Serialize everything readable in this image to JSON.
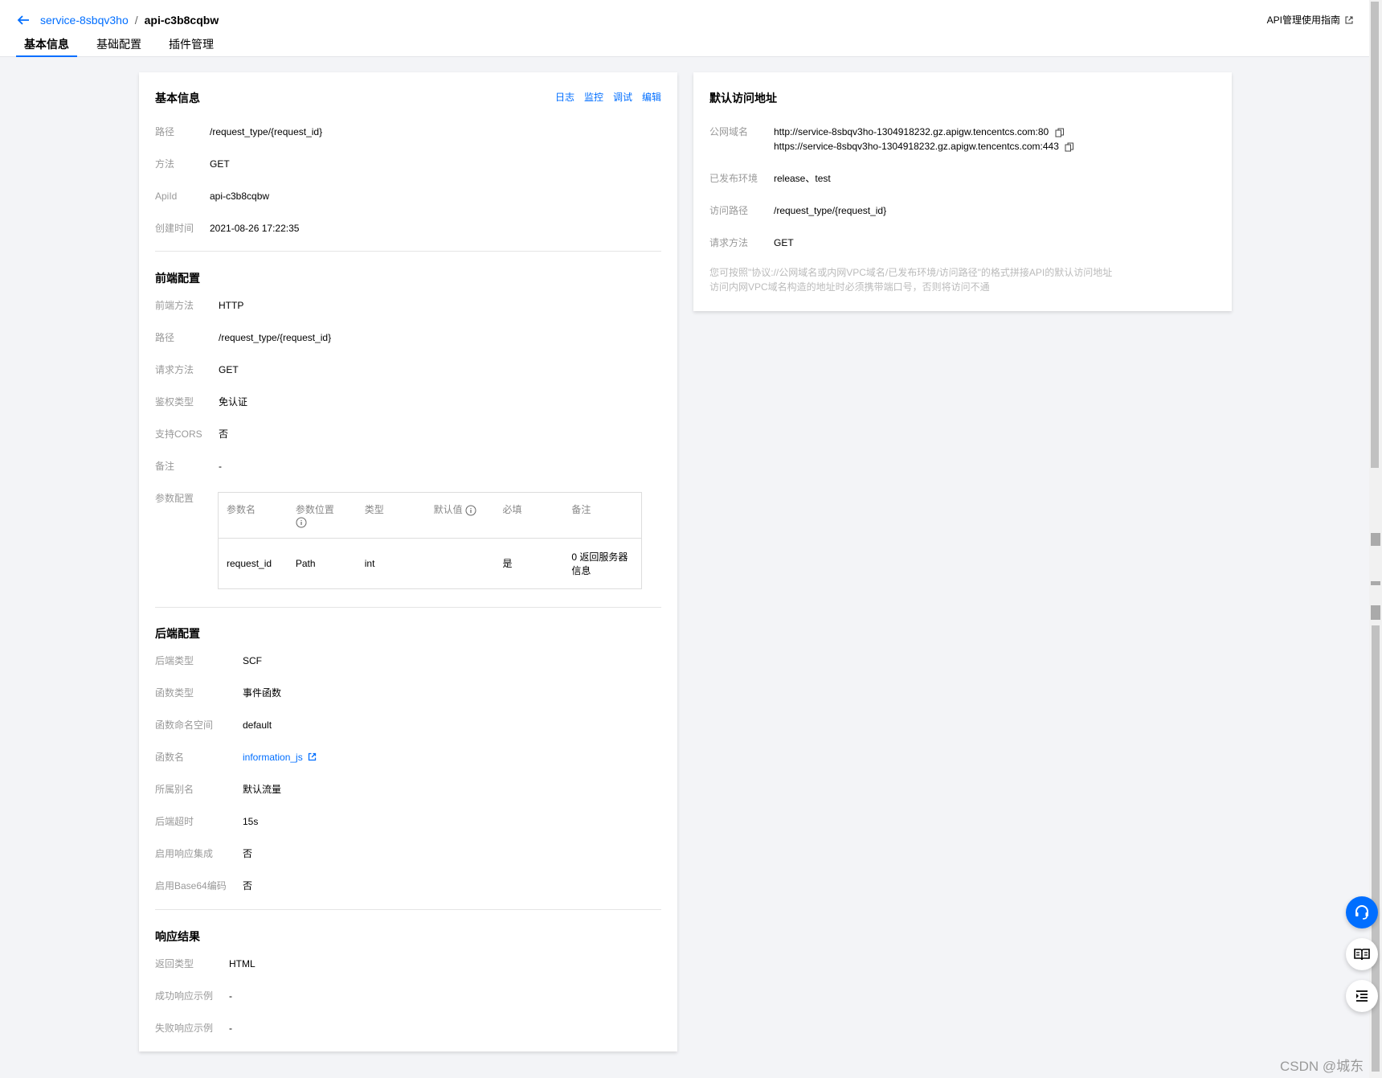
{
  "header": {
    "breadcrumb": {
      "service": "service-8sbqv3ho",
      "separator": "/",
      "current": "api-c3b8cqbw"
    },
    "guide_link": "API管理使用指南",
    "tabs": [
      "基本信息",
      "基础配置",
      "插件管理"
    ]
  },
  "basic_info": {
    "title": "基本信息",
    "actions": [
      "日志",
      "监控",
      "调试",
      "编辑"
    ],
    "rows": [
      {
        "label": "路径",
        "value": "/request_type/{request_id}"
      },
      {
        "label": "方法",
        "value": "GET"
      },
      {
        "label": "ApiId",
        "value": "api-c3b8cqbw"
      },
      {
        "label": "创建时间",
        "value": "2021-08-26 17:22:35"
      }
    ]
  },
  "frontend": {
    "title": "前端配置",
    "rows": [
      {
        "label": "前端方法",
        "value": "HTTP"
      },
      {
        "label": "路径",
        "value": "/request_type/{request_id}"
      },
      {
        "label": "请求方法",
        "value": "GET"
      },
      {
        "label": "鉴权类型",
        "value": "免认证"
      },
      {
        "label": "支持CORS",
        "value": "否"
      },
      {
        "label": "备注",
        "value": "-"
      }
    ],
    "param_label": "参数配置",
    "param_headers": [
      "参数名",
      "参数位置",
      "类型",
      "默认值",
      "必填",
      "备注"
    ],
    "param_rows": [
      {
        "name": "request_id",
        "position": "Path",
        "type": "int",
        "default": "",
        "required": "是",
        "note": "0 返回服务器信息"
      }
    ]
  },
  "backend": {
    "title": "后端配置",
    "rows": [
      {
        "label": "后端类型",
        "value": "SCF"
      },
      {
        "label": "函数类型",
        "value": "事件函数"
      },
      {
        "label": "函数命名空间",
        "value": "default"
      },
      {
        "label": "函数名",
        "value": "information_js"
      },
      {
        "label": "所属别名",
        "value": "默认流量"
      },
      {
        "label": "后端超时",
        "value": "15s"
      },
      {
        "label": "启用响应集成",
        "value": "否"
      },
      {
        "label": "启用Base64编码",
        "value": "否"
      }
    ]
  },
  "response": {
    "title": "响应结果",
    "rows": [
      {
        "label": "返回类型",
        "value": "HTML"
      },
      {
        "label": "成功响应示例",
        "value": "-"
      },
      {
        "label": "失败响应示例",
        "value": "-"
      }
    ]
  },
  "default_access": {
    "title": "默认访问地址",
    "domain_label": "公网域名",
    "domains": [
      "http://service-8sbqv3ho-1304918232.gz.apigw.tencentcs.com:80",
      "https://service-8sbqv3ho-1304918232.gz.apigw.tencentcs.com:443"
    ],
    "rows": [
      {
        "label": "已发布环境",
        "value": "release、test"
      },
      {
        "label": "访问路径",
        "value": "/request_type/{request_id}"
      },
      {
        "label": "请求方法",
        "value": "GET"
      }
    ],
    "hint_lines": [
      "您可按照\"协议://公网域名或内网VPC域名/已发布环境/访问路径\"的格式拼接API的默认访问地址",
      "访问内网VPC域名构造的地址时必须携带端口号，否则将访问不通"
    ]
  },
  "watermark": "CSDN @城东",
  "colors": {
    "accent": "#006eff",
    "label": "#999999",
    "background": "#f3f4f7"
  }
}
